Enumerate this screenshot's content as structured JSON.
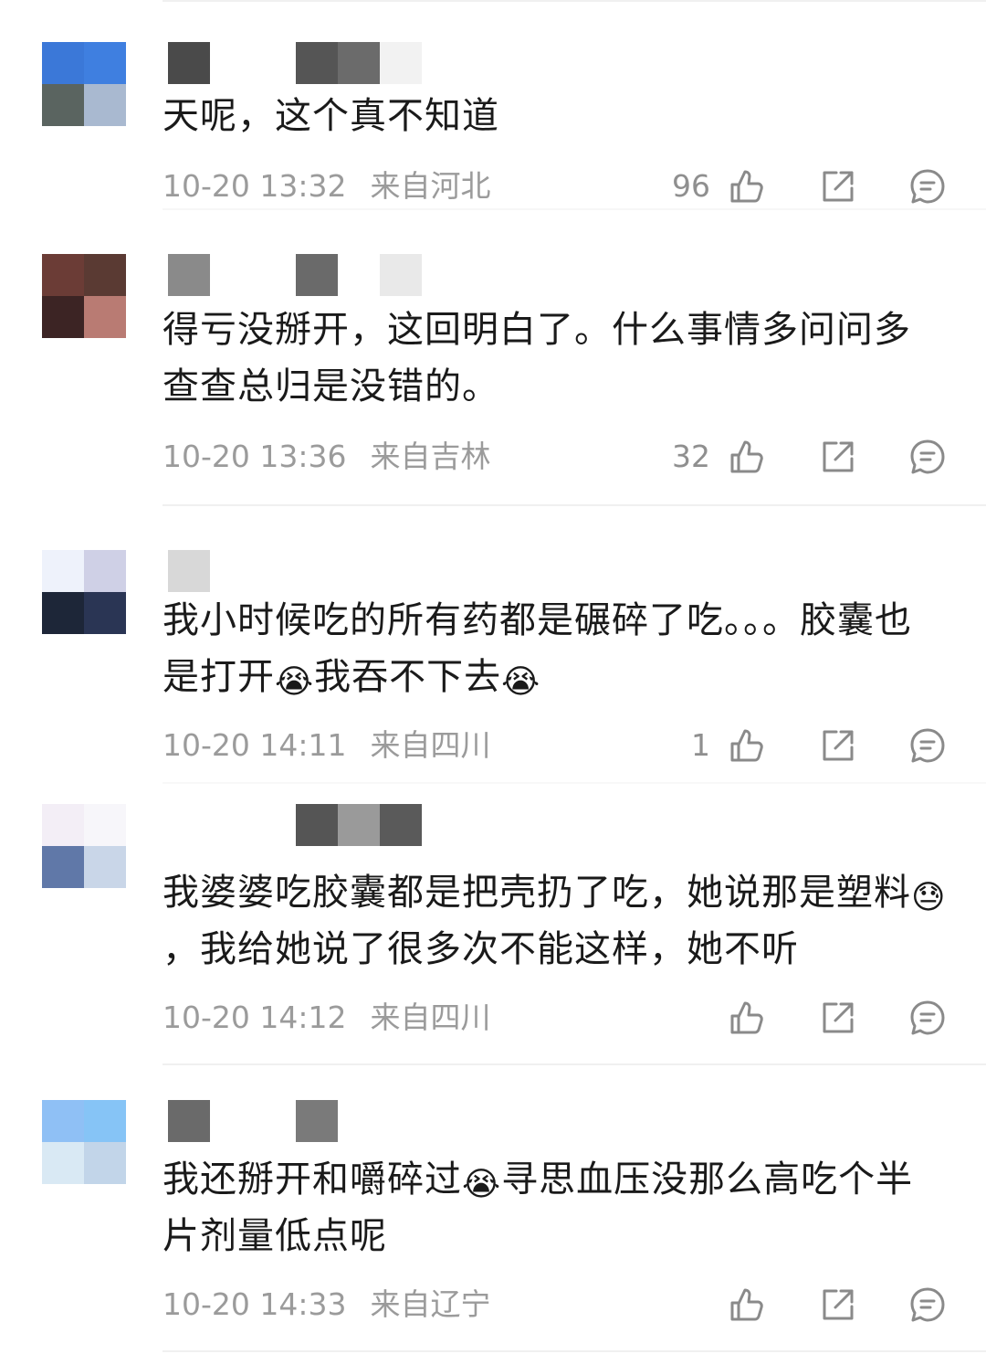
{
  "colors": {
    "background": "#ffffff",
    "text": "#1a1a1a",
    "meta": "#9b9b9b",
    "icon": "#8a8a8a",
    "divider": "#f0f0f0"
  },
  "icons": {
    "like": "thumbs-up-icon",
    "share": "share-icon",
    "reply": "comment-icon"
  },
  "comments": [
    {
      "text": "天呢，这个真不知道",
      "time": "10-20 13:32",
      "location": "来自河北",
      "likes": "96",
      "avatar_colors": [
        "#3b78d8",
        "#3f7fe0",
        "#5a6460",
        "#a9b9d0"
      ],
      "username_blocks": [
        "#4a4a4a",
        "#ffffff",
        "#555555",
        "#6b6b6b",
        "#f2f2f2"
      ]
    },
    {
      "text": "得亏没掰开，这回明白了。什么事情多问问多查查总归是没错的。",
      "time": "10-20 13:36",
      "location": "来自吉林",
      "likes": "32",
      "avatar_colors": [
        "#6b3c36",
        "#5a3a33",
        "#3c2424",
        "#b97b73"
      ],
      "username_blocks": [
        "#8a8a8a",
        "#ffffff",
        "#6a6a6a",
        "#ffffff",
        "#e9e9e9"
      ]
    },
    {
      "text_parts": [
        "我小时候吃的所有药都是碾碎了吃。。。胶囊也是打开",
        "😭",
        "我吞不下去",
        "😭"
      ],
      "time": "10-20 14:11",
      "location": "来自四川",
      "likes": "1",
      "avatar_colors": [
        "#eef2fb",
        "#cfd0e6",
        "#1d2638",
        "#2a3554"
      ],
      "username_blocks": [
        "#d8d8d8",
        "#ffffff",
        "#ffffff",
        "#ffffff",
        "#ffffff"
      ]
    },
    {
      "text_parts": [
        "我婆婆吃胶囊都是把壳扔了吃，她说那是塑料",
        "😓",
        "，我给她说了很多次不能这样，她不听"
      ],
      "time": "10-20 14:12",
      "location": "来自四川",
      "likes": "",
      "avatar_colors": [
        "#f3eef6",
        "#f7f6fa",
        "#6078a8",
        "#c9d6e8"
      ],
      "username_blocks": [
        "#ffffff",
        "#ffffff",
        "#555555",
        "#9a9a9a",
        "#5a5a5a"
      ]
    },
    {
      "text_parts": [
        "我还掰开和嚼碎过",
        "😭",
        "寻思血压没那么高吃个半片剂量低点呢"
      ],
      "time": "10-20 14:33",
      "location": "来自辽宁",
      "likes": "",
      "avatar_colors": [
        "#8fc0f5",
        "#86c4f6",
        "#d9e9f4",
        "#c2d5e9"
      ],
      "username_blocks": [
        "#6a6a6a",
        "#ffffff",
        "#7a7a7a",
        "#ffffff",
        "#ffffff"
      ]
    }
  ]
}
